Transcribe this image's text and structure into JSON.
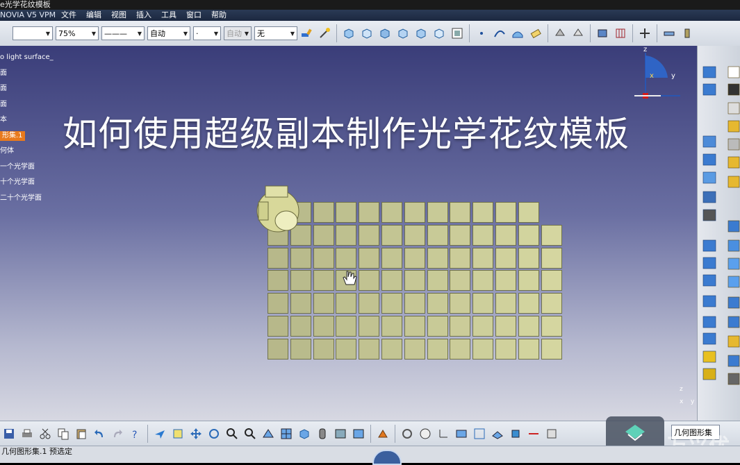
{
  "window": {
    "title": "e光学花纹模板"
  },
  "menubar": {
    "app": "NOVIA V5 VPM",
    "items": [
      "文件",
      "编辑",
      "视图",
      "插入",
      "工具",
      "窗口",
      "帮助"
    ]
  },
  "toolbar": {
    "color_value": "",
    "transparency_value": "75%",
    "linetype_value": "———",
    "linewidth_value": "自动",
    "point_value": "·",
    "layer_value": "自动",
    "filter_value": "无"
  },
  "tree": {
    "items": [
      "o light surface_",
      "面",
      "面",
      "面",
      "本",
      "形集.1",
      "何体",
      "一个光学面",
      "十个光学面",
      "二十个光学面"
    ],
    "highlight_index": 5
  },
  "overlay": {
    "title": "如何使用超级副本制作光学花纹模板"
  },
  "compass": {
    "z": "z",
    "x": "x",
    "y": "y"
  },
  "axis_small": {
    "z": "z",
    "x": "x",
    "y": "y"
  },
  "status": {
    "text": "几何图形集.1 预选定"
  },
  "bottom_dropdown": {
    "value": "几何图形集"
  },
  "watermark": {
    "text": "万兴优"
  },
  "colors": {
    "accent": "#e87a1e",
    "cell": "#d7d9a2",
    "viewport_top": "#3a3d79"
  },
  "pattern": {
    "rows": 7,
    "cols": 13,
    "first_row_cols": 12
  }
}
